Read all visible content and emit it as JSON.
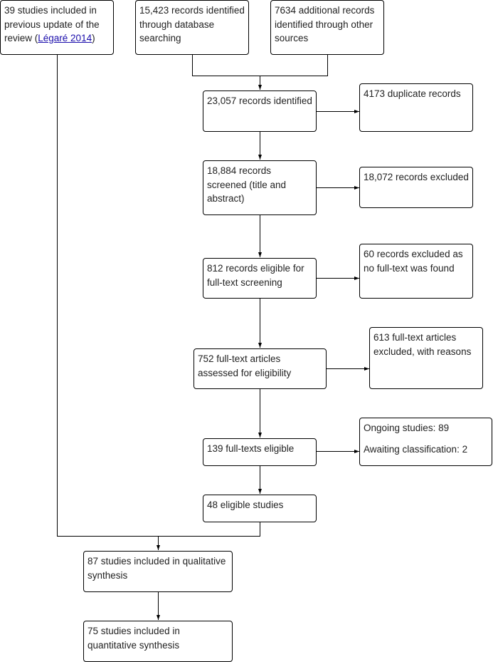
{
  "flowchart": {
    "previous_update": {
      "prefix": "39 studies included in previous update of the review (",
      "link_text": "Légaré 2014",
      "suffix": ")"
    },
    "database_search": "15,423 records identified through database searching",
    "other_sources": "7634 additional records identified through other sources",
    "identified": "23,057 records identified",
    "duplicates": "4173 duplicate records",
    "screened": "18,884 records screened (title and abstract)",
    "excluded_screen": "18,072 records excluded",
    "eligible_fulltext_screening": "812 records eligible for full-text screening",
    "no_fulltext": "60 records excluded as no full-text was found",
    "assessed": "752 full-text articles assessed for eligibility",
    "excluded_reasons": "613 full-text articles excluded, with reasons",
    "fulltexts_eligible": "139 full-texts eligible",
    "ongoing": "Ongoing studies: 89",
    "awaiting": "Awaiting classification: 2",
    "eligible_studies": "48 eligible studies",
    "qualitative": "87 studies included in qualitative synthesis",
    "quantitative": "75 studies included in quantitative synthesis"
  }
}
